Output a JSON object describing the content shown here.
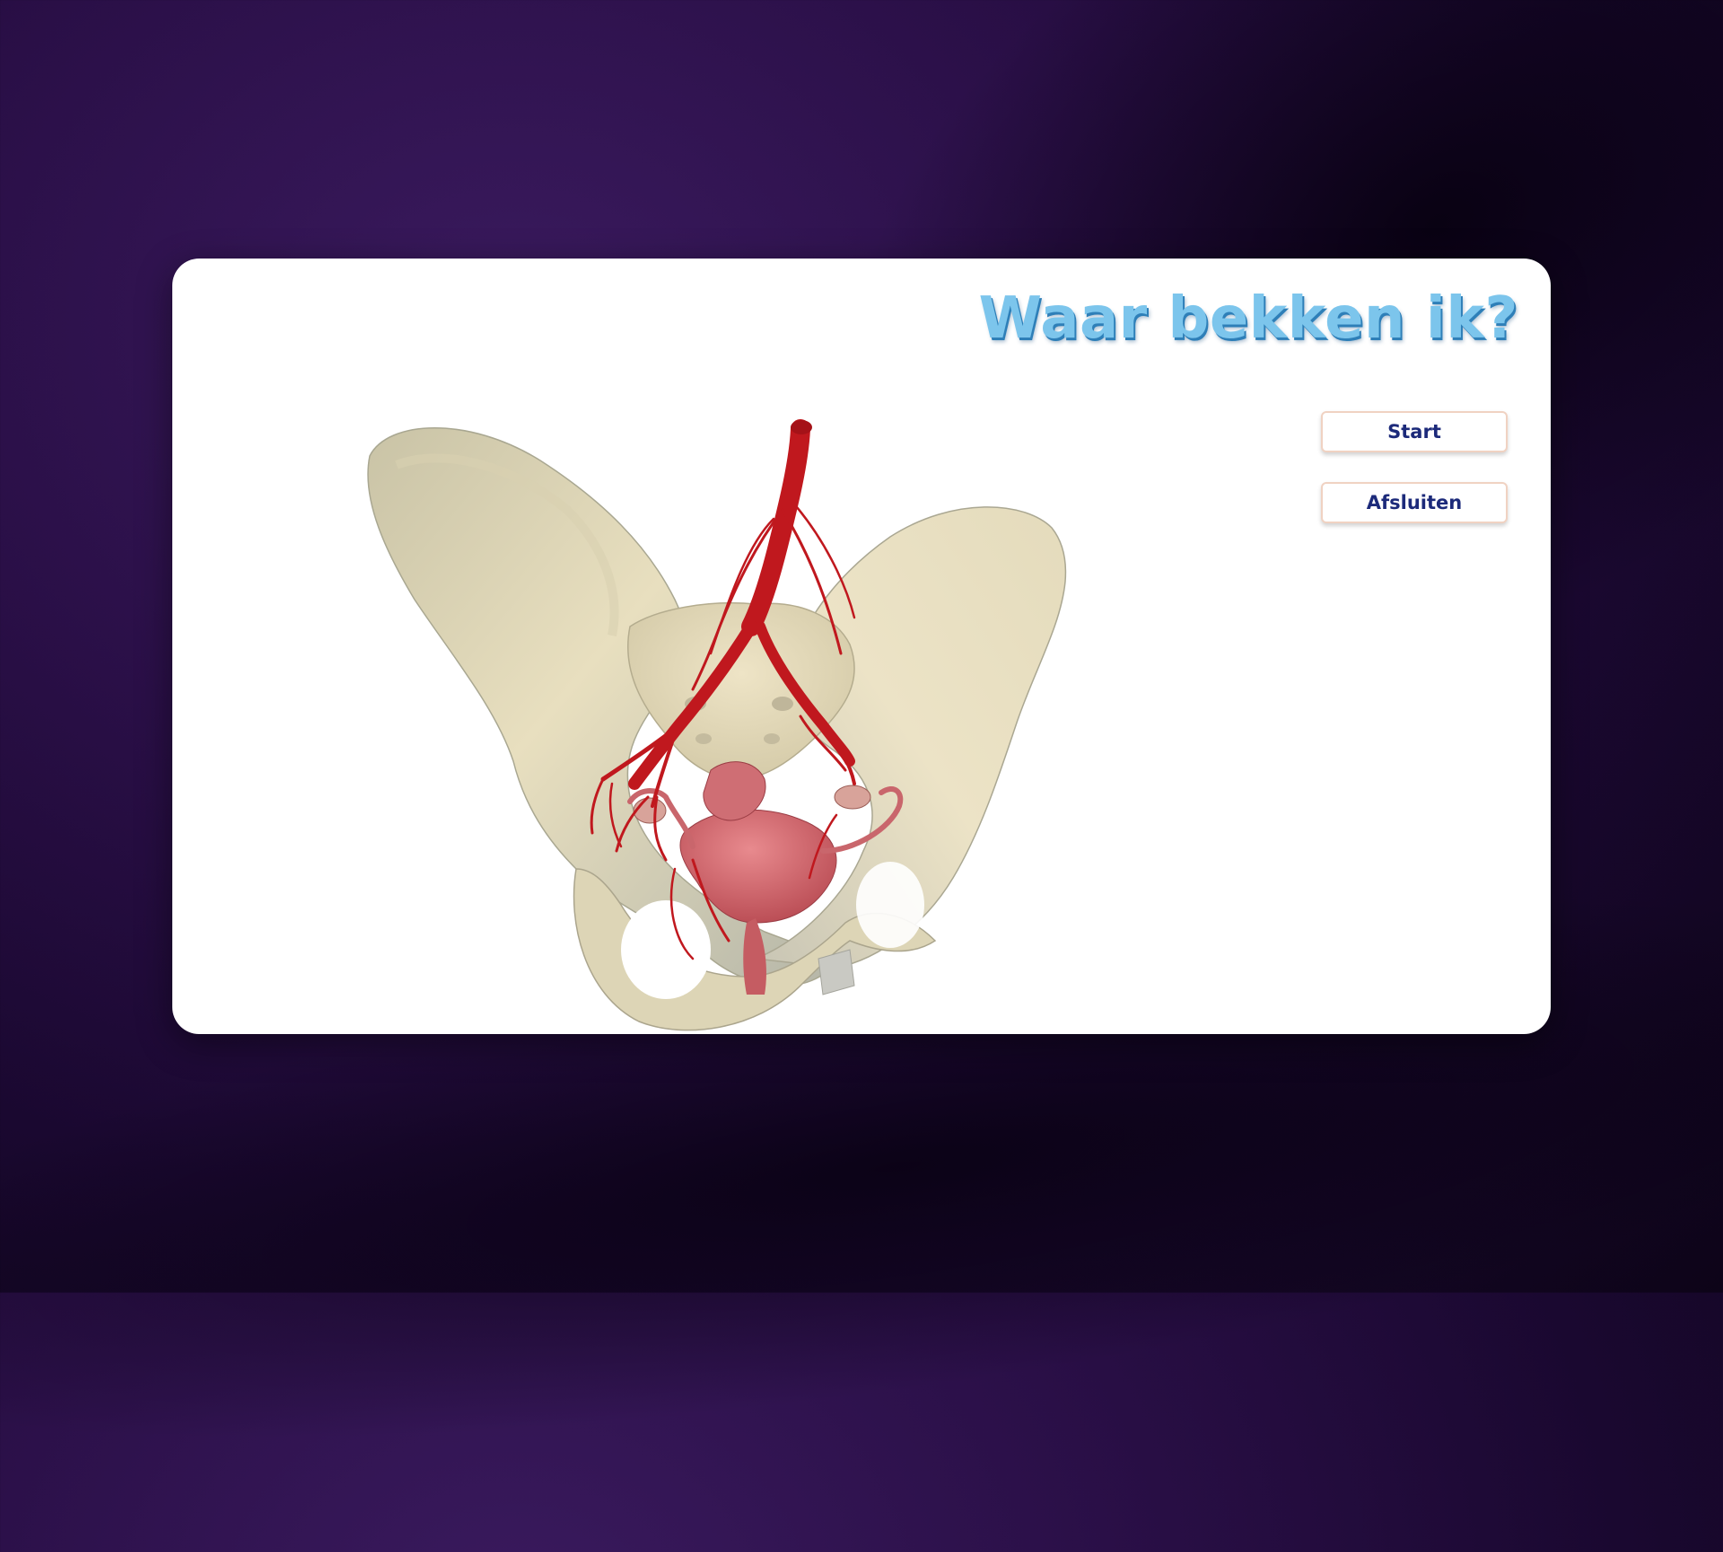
{
  "app": {
    "title": "Waar bekken ik?"
  },
  "menu": {
    "start_label": "Start",
    "exit_label": "Afsluiten"
  },
  "viewport": {
    "model": "pelvis-3d-model"
  },
  "colors": {
    "background": "#2a0f47",
    "title": "#7cc5ec",
    "title_shadow": "#2e7fb8",
    "button_text": "#1c2a7a",
    "button_border": "#f0d2c2",
    "bone": "#e6dcbc",
    "artery": "#c0181e",
    "uterus": "#d86a70"
  }
}
